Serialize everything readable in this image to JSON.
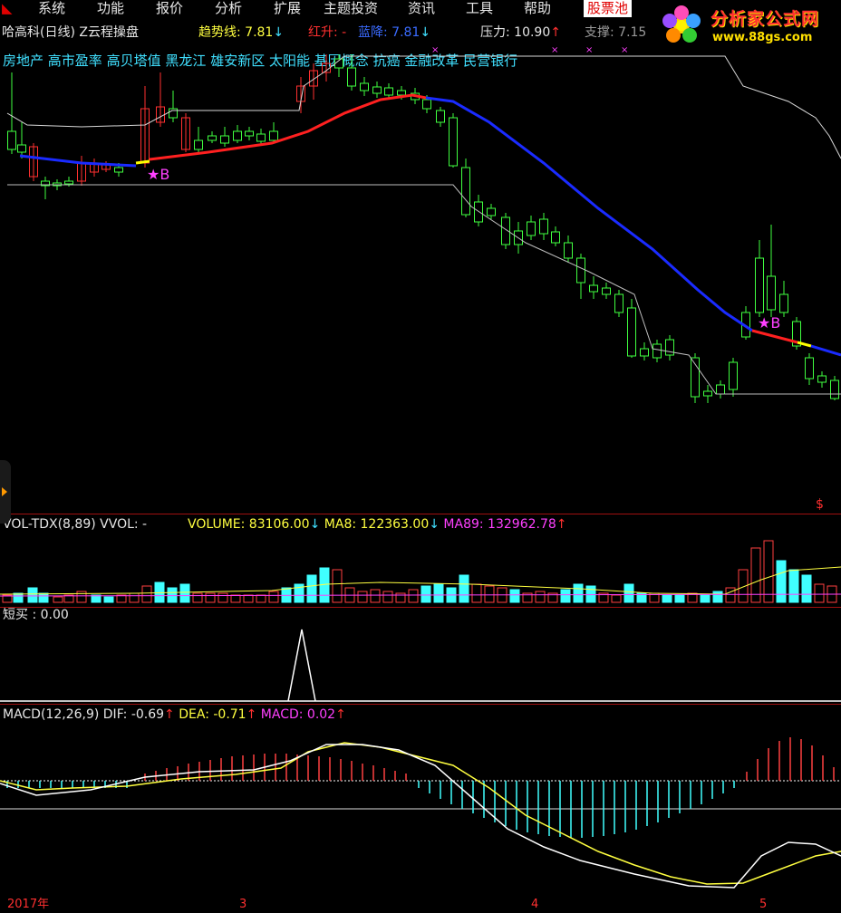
{
  "menu": {
    "items": [
      "系统",
      "功能",
      "报价",
      "分析",
      "扩展",
      "主题投资",
      "资讯",
      "工具",
      "帮助"
    ],
    "highlight": "股票池"
  },
  "logo": {
    "title": "分析家公式网",
    "url": "www.88gs.com"
  },
  "header": {
    "stock": "哈高科(日线)",
    "indicator": "Z云程操盘",
    "trend_label": "趋势线:",
    "trend_value": "7.81",
    "red_label": "红升:",
    "red_value": "-",
    "blue_label": "蓝降:",
    "blue_value": "7.81",
    "pressure_label": "压力:",
    "pressure_value": "10.90",
    "support_label": "支撑:",
    "support_value": "7.15"
  },
  "concepts": [
    "房地产",
    "高市盈率",
    "高贝塔值",
    "黑龙江",
    "雄安新区",
    "太阳能",
    "基因概念",
    "抗癌",
    "金融改革",
    "民营银行"
  ],
  "signals": {
    "buy": "B"
  },
  "vol": {
    "name": "VOL-TDX(8,89)",
    "vvol": "VVOL: -",
    "volume": "VOLUME: 83106.00",
    "ma8": "MA8: 122363.00",
    "ma89": "MA89: 132962.78"
  },
  "short": {
    "label": "短买",
    "value": ": 0.00"
  },
  "macd": {
    "name": "MACD(12,26,9)",
    "dif": "DIF: -0.69",
    "dea": "DEA: -0.71",
    "macd": "MACD: 0.02"
  },
  "xaxis": {
    "year": "2017年",
    "ticks": [
      "3",
      "4",
      "5"
    ]
  },
  "colors": {
    "up": "#ff3030",
    "down": "#40ff40",
    "vol_up": "#ff4040",
    "vol_down": "#40ffff",
    "trend_red": "#ff2020",
    "trend_blue": "#1a2bff",
    "dea": "#ffff40"
  }
}
